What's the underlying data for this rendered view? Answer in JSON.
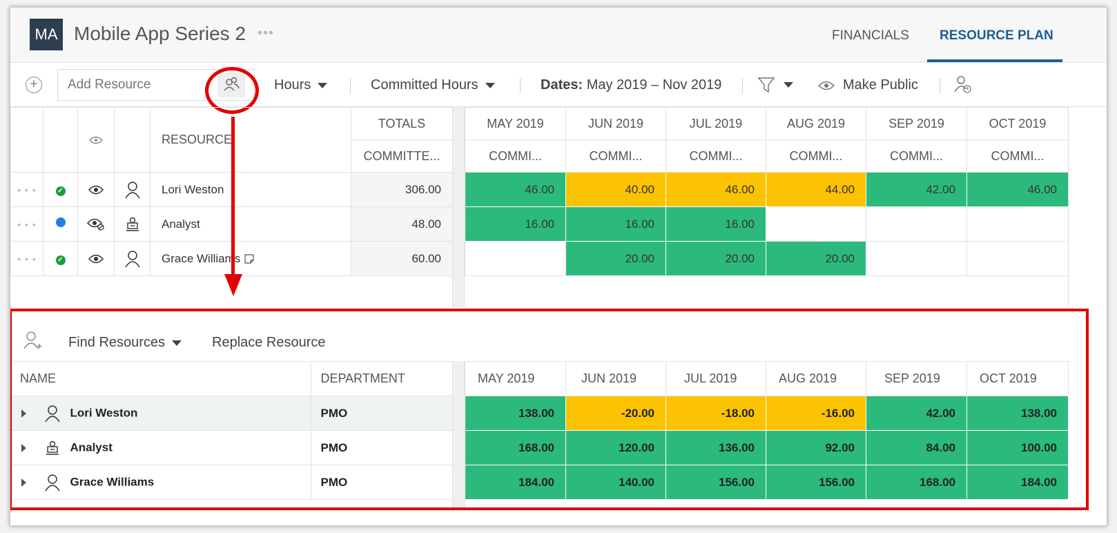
{
  "header": {
    "avatar": "MA",
    "title": "Mobile App Series 2",
    "more": "•••",
    "tabs": [
      "FINANCIALS",
      "RESOURCE PLAN"
    ]
  },
  "toolbar": {
    "add_placeholder": "Add Resource",
    "unit": "Hours",
    "measure": "Committed Hours",
    "dates_label": "Dates:",
    "dates_value": "May 2019 – Nov 2019",
    "make_public": "Make Public"
  },
  "plan": {
    "headers": {
      "resource": "RESOURCE",
      "totals": "TOTALS",
      "committed": "COMMITTE...",
      "committed_short": "COMMI..."
    },
    "months": [
      "MAY 2019",
      "JUN 2019",
      "JUL 2019",
      "AUG 2019",
      "SEP 2019",
      "OCT 2019"
    ],
    "rows": [
      {
        "name": "Lori Weston",
        "total": "306.00",
        "status": "green-check",
        "type": "person",
        "values": [
          "46.00",
          "40.00",
          "46.00",
          "44.00",
          "42.00",
          "46.00"
        ],
        "colors": [
          "g",
          "y",
          "y",
          "y",
          "g",
          "g"
        ]
      },
      {
        "name": "Analyst",
        "total": "48.00",
        "status": "blue-dot",
        "type": "role",
        "values": [
          "16.00",
          "16.00",
          "16.00",
          "",
          "",
          ""
        ],
        "colors": [
          "g",
          "g",
          "g",
          "w",
          "w",
          "w"
        ]
      },
      {
        "name": "Grace Williams",
        "total": "60.00",
        "status": "green-check",
        "type": "person",
        "values": [
          "",
          "20.00",
          "20.00",
          "20.00",
          "",
          ""
        ],
        "colors": [
          "w",
          "g",
          "g",
          "g",
          "w",
          "w"
        ]
      }
    ]
  },
  "finder": {
    "find_resources": "Find Resources",
    "replace_resource": "Replace Resource",
    "headers": {
      "name": "NAME",
      "department": "DEPARTMENT"
    },
    "months": [
      "MAY 2019",
      "JUN 2019",
      "JUL 2019",
      "AUG 2019",
      "SEP 2019",
      "OCT 2019"
    ],
    "rows": [
      {
        "name": "Lori Weston",
        "department": "PMO",
        "type": "person",
        "values": [
          "138.00",
          "-20.00",
          "-18.00",
          "-16.00",
          "42.00",
          "138.00"
        ],
        "colors": [
          "g",
          "y",
          "y",
          "y",
          "g",
          "g"
        ]
      },
      {
        "name": "Analyst",
        "department": "PMO",
        "type": "role",
        "values": [
          "168.00",
          "120.00",
          "136.00",
          "92.00",
          "84.00",
          "100.00"
        ],
        "colors": [
          "g",
          "g",
          "g",
          "g",
          "g",
          "g"
        ]
      },
      {
        "name": "Grace Williams",
        "department": "PMO",
        "type": "person",
        "values": [
          "184.00",
          "140.00",
          "156.00",
          "156.00",
          "168.00",
          "184.00"
        ],
        "colors": [
          "g",
          "g",
          "g",
          "g",
          "g",
          "g"
        ]
      }
    ]
  },
  "colors": {
    "green": "#2cba7c",
    "yellow": "#fcc302",
    "accent": "#1f5d96",
    "highlight": "#e30000"
  }
}
